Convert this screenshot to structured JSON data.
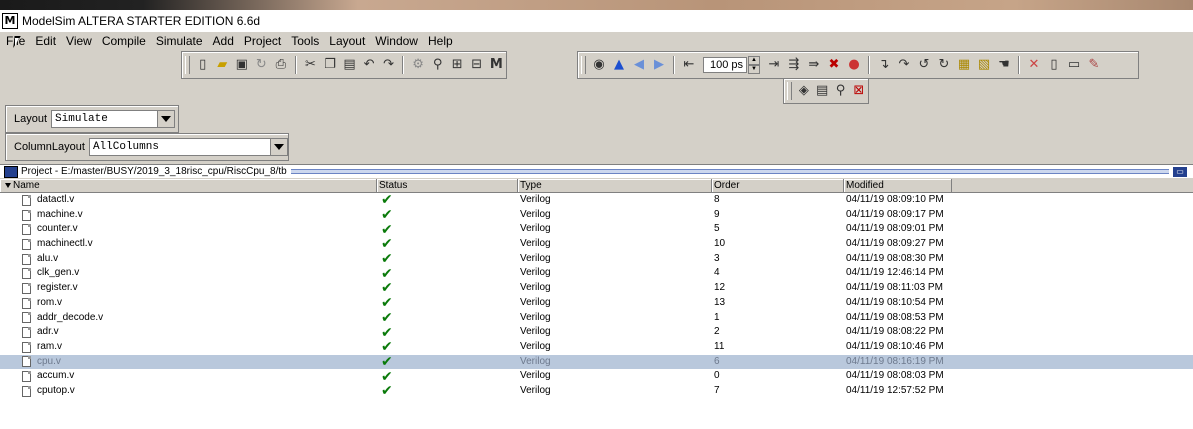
{
  "window": {
    "title": "ModelSim ALTERA STARTER EDITION 6.6d",
    "app_icon": "M"
  },
  "menu": [
    "File",
    "Edit",
    "View",
    "Compile",
    "Simulate",
    "Add",
    "Project",
    "Tools",
    "Layout",
    "Window",
    "Help"
  ],
  "toolbar": {
    "sim_time": "100 ps"
  },
  "layout": {
    "label": "Layout",
    "value": "Simulate"
  },
  "column_layout": {
    "label": "ColumnLayout",
    "value": "AllColumns"
  },
  "project": {
    "title": "Project - E:/master/BUSY/2019_3_18risc_cpu/RiscCpu_8/tb",
    "columns": [
      "Name",
      "Status",
      "Type",
      "Order",
      "Modified"
    ],
    "files": [
      {
        "name": "datactl.v",
        "type": "Verilog",
        "order": "8",
        "modified": "04/11/19 08:09:10 PM"
      },
      {
        "name": "machine.v",
        "type": "Verilog",
        "order": "9",
        "modified": "04/11/19 08:09:17 PM"
      },
      {
        "name": "counter.v",
        "type": "Verilog",
        "order": "5",
        "modified": "04/11/19 08:09:01 PM"
      },
      {
        "name": "machinectl.v",
        "type": "Verilog",
        "order": "10",
        "modified": "04/11/19 08:09:27 PM"
      },
      {
        "name": "alu.v",
        "type": "Verilog",
        "order": "3",
        "modified": "04/11/19 08:08:30 PM"
      },
      {
        "name": "clk_gen.v",
        "type": "Verilog",
        "order": "4",
        "modified": "04/11/19 12:46:14 PM"
      },
      {
        "name": "register.v",
        "type": "Verilog",
        "order": "12",
        "modified": "04/11/19 08:11:03 PM"
      },
      {
        "name": "rom.v",
        "type": "Verilog",
        "order": "13",
        "modified": "04/11/19 08:10:54 PM"
      },
      {
        "name": "addr_decode.v",
        "type": "Verilog",
        "order": "1",
        "modified": "04/11/19 08:08:53 PM"
      },
      {
        "name": "adr.v",
        "type": "Verilog",
        "order": "2",
        "modified": "04/11/19 08:08:22 PM"
      },
      {
        "name": "ram.v",
        "type": "Verilog",
        "order": "11",
        "modified": "04/11/19 08:10:46 PM"
      },
      {
        "name": "cpu.v",
        "type": "Verilog",
        "order": "6",
        "modified": "04/11/19 08:16:19 PM",
        "selected": true
      },
      {
        "name": "accum.v",
        "type": "Verilog",
        "order": "0",
        "modified": "04/11/19 08:08:03 PM"
      },
      {
        "name": "cputop.v",
        "type": "Verilog",
        "order": "7",
        "modified": "04/11/19 12:57:52 PM"
      }
    ]
  },
  "colors": {
    "selected_row": "#b9c8dc",
    "check": "#0a7a0a"
  }
}
